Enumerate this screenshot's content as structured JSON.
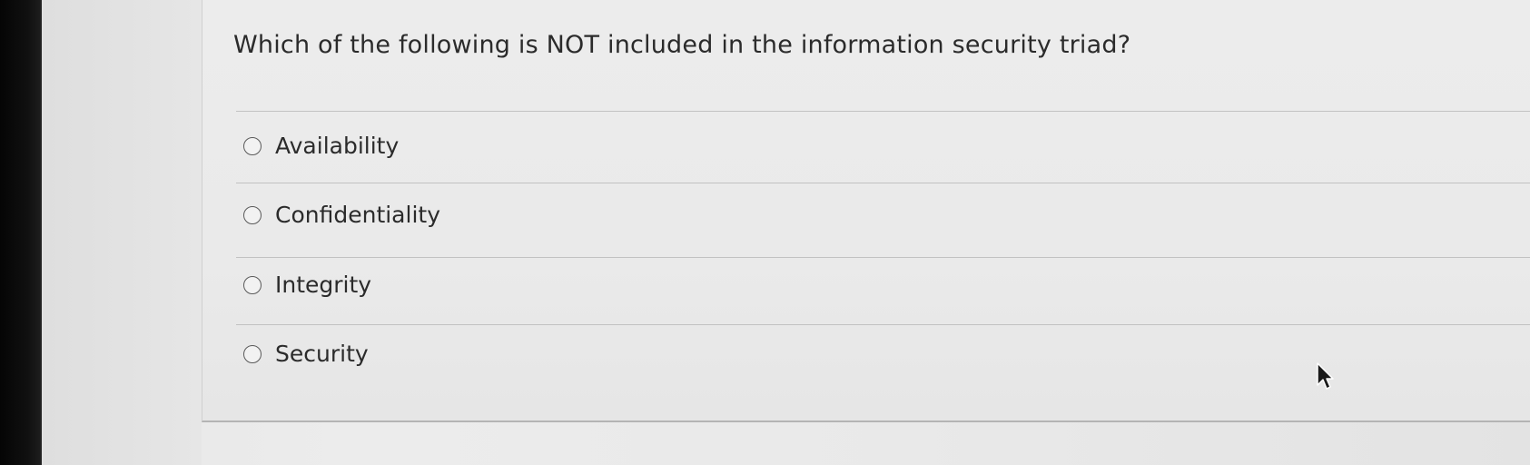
{
  "question": {
    "text": "Which of the following is NOT included in the information security triad?"
  },
  "options": [
    {
      "label": "Availability",
      "selected": false
    },
    {
      "label": "Confidentiality",
      "selected": false
    },
    {
      "label": "Integrity",
      "selected": false
    },
    {
      "label": "Security",
      "selected": false
    }
  ],
  "cursor": {
    "icon": "mouse-pointer-icon"
  }
}
